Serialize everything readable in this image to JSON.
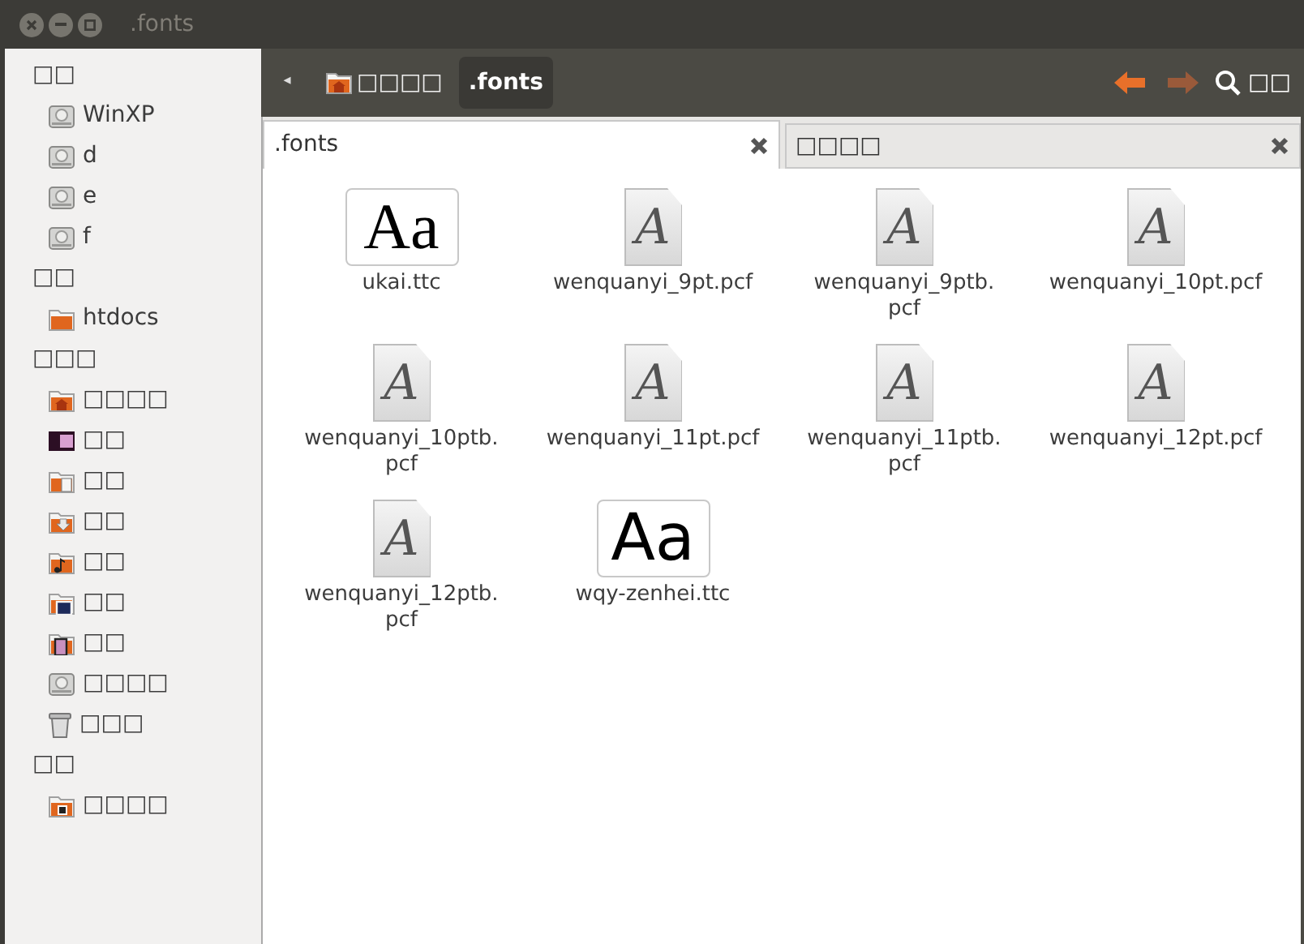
{
  "window": {
    "title": ".fonts"
  },
  "sidebar": {
    "sections": [
      {
        "heading": "□□",
        "items": [
          {
            "label": "WinXP",
            "kind": "drive"
          },
          {
            "label": "d",
            "kind": "drive"
          },
          {
            "label": "e",
            "kind": "drive"
          },
          {
            "label": "f",
            "kind": "drive"
          }
        ]
      },
      {
        "heading": "□□",
        "items": [
          {
            "label": "htdocs",
            "kind": "folder"
          }
        ]
      },
      {
        "heading": "□□□",
        "items": [
          {
            "label": "□□□□",
            "kind": "home"
          },
          {
            "label": "□□",
            "kind": "desktop"
          },
          {
            "label": "□□",
            "kind": "documents"
          },
          {
            "label": "□□",
            "kind": "downloads"
          },
          {
            "label": "□□",
            "kind": "music"
          },
          {
            "label": "□□",
            "kind": "pictures"
          },
          {
            "label": "□□",
            "kind": "videos"
          },
          {
            "label": "□□□□",
            "kind": "filesystem"
          },
          {
            "label": "□□□",
            "kind": "trash"
          }
        ]
      },
      {
        "heading": "□□",
        "items": [
          {
            "label": "□□□□",
            "kind": "network"
          }
        ]
      }
    ]
  },
  "toolbar": {
    "back_arrow": "◂",
    "path": [
      {
        "label": "□□□□",
        "selected": false,
        "kind": "home"
      },
      {
        "label": ".fonts",
        "selected": true,
        "kind": "plain"
      }
    ],
    "search_label": "□□"
  },
  "tabs": [
    {
      "label": ".fonts",
      "selected": true
    },
    {
      "label": "□□□□",
      "selected": false
    }
  ],
  "files": [
    {
      "name": "ukai.ttc",
      "kind": "serif-preview",
      "preview": "Aa"
    },
    {
      "name": "wenquanyi_9pt.pcf",
      "kind": "pcf",
      "glyph": "A"
    },
    {
      "name": "wenquanyi_9ptb.\npcf",
      "kind": "pcf",
      "glyph": "A"
    },
    {
      "name": "wenquanyi_10pt.pcf",
      "kind": "pcf",
      "glyph": "A"
    },
    {
      "name": "wenquanyi_10ptb.\npcf",
      "kind": "pcf",
      "glyph": "A"
    },
    {
      "name": "wenquanyi_11pt.pcf",
      "kind": "pcf",
      "glyph": "A"
    },
    {
      "name": "wenquanyi_11ptb.\npcf",
      "kind": "pcf",
      "glyph": "A"
    },
    {
      "name": "wenquanyi_12pt.pcf",
      "kind": "pcf",
      "glyph": "A"
    },
    {
      "name": "wenquanyi_12ptb.\npcf",
      "kind": "pcf",
      "glyph": "A"
    },
    {
      "name": "wqy-zenhei.ttc",
      "kind": "sans-preview",
      "preview": "Aa"
    }
  ]
}
